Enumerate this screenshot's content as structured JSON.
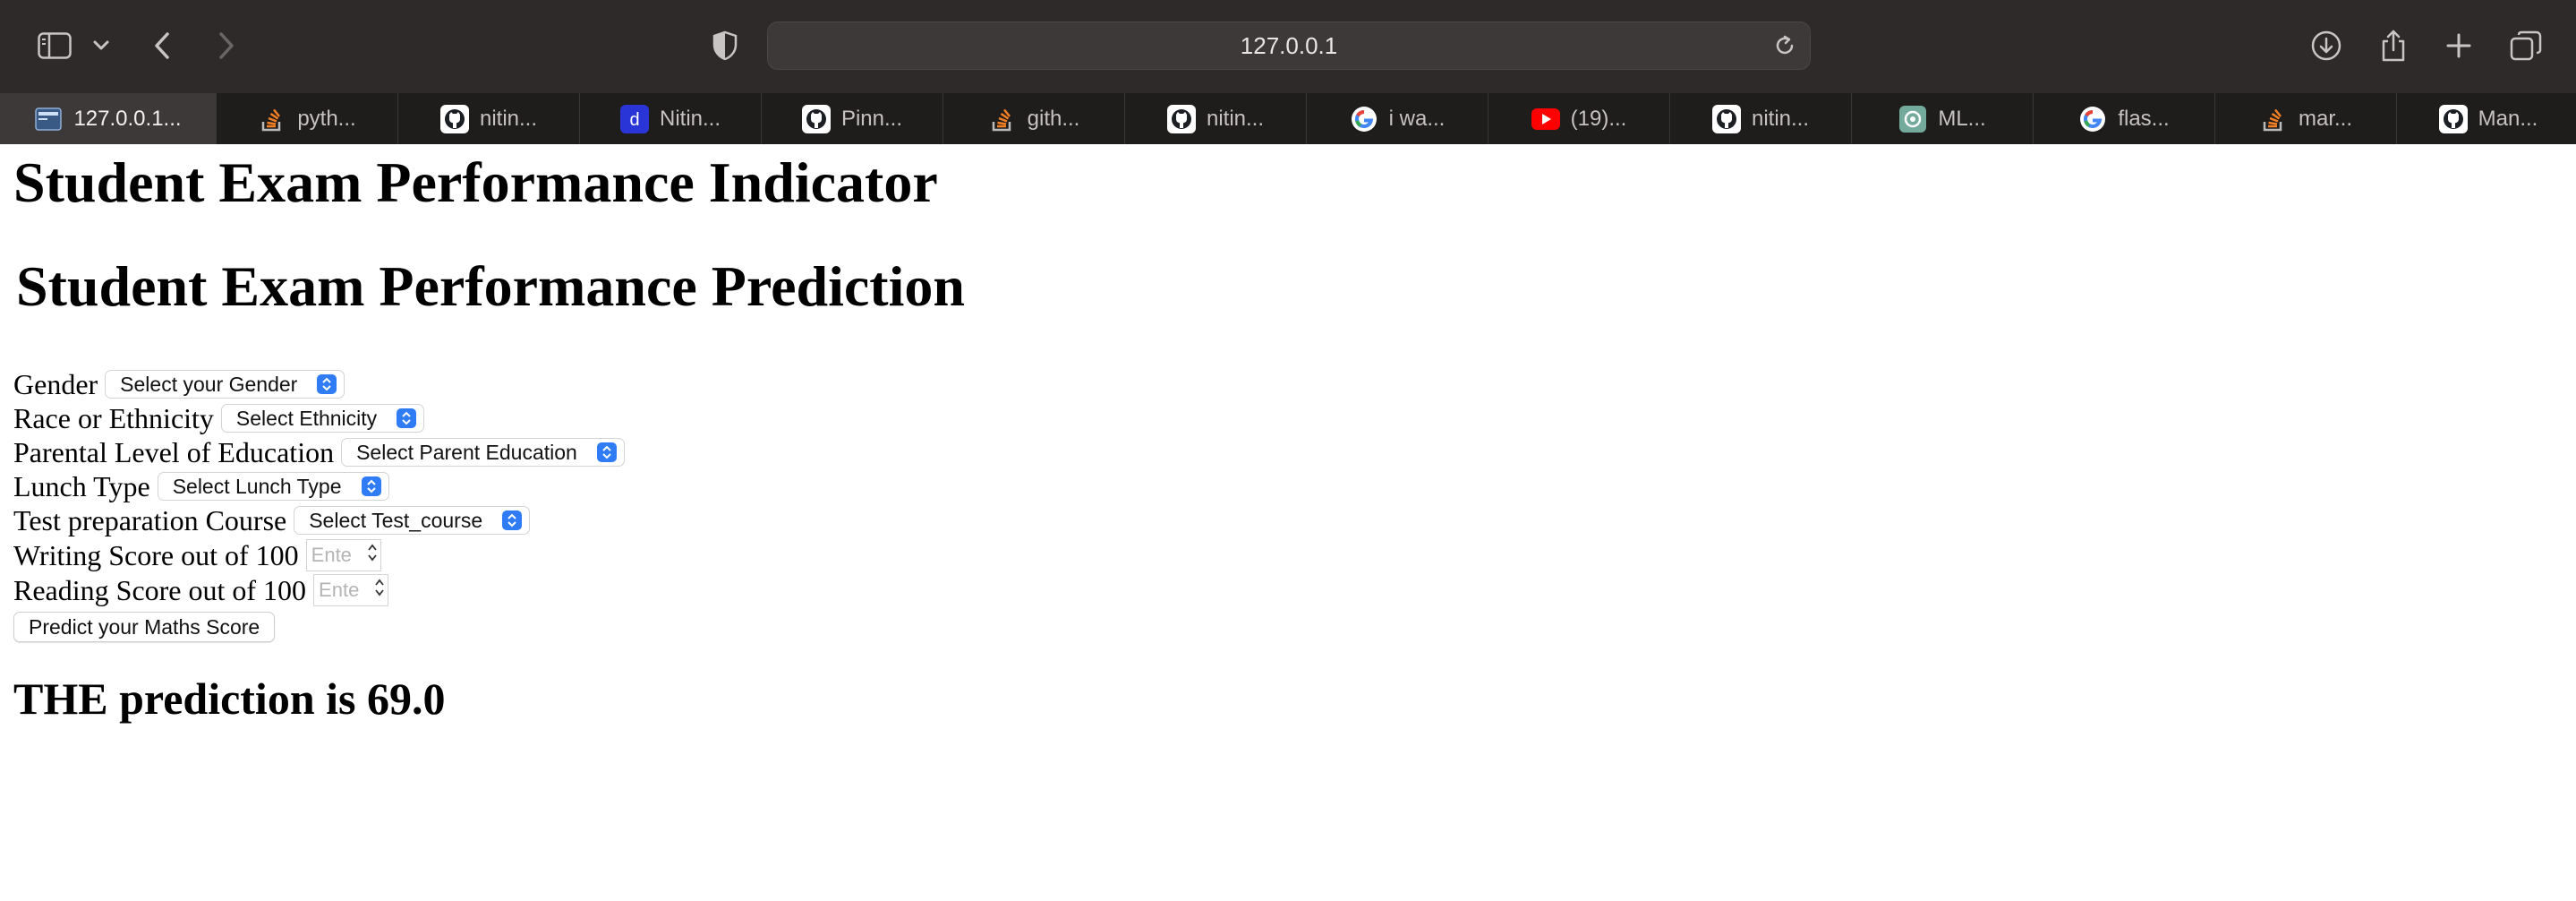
{
  "browser": {
    "address": "127.0.0.1",
    "tabs": [
      {
        "label": "127.0.0.1...",
        "icon": "site-favicon-icon",
        "active": true
      },
      {
        "label": "pyth...",
        "icon": "stackoverflow-icon"
      },
      {
        "label": "nitin...",
        "icon": "github-icon"
      },
      {
        "label": "Nitin...",
        "icon": "dev-letter-d-icon"
      },
      {
        "label": "Pinn...",
        "icon": "github-icon"
      },
      {
        "label": "gith...",
        "icon": "stackoverflow-icon"
      },
      {
        "label": "nitin...",
        "icon": "github-icon"
      },
      {
        "label": "i wa...",
        "icon": "google-icon"
      },
      {
        "label": "(19)...",
        "icon": "youtube-icon"
      },
      {
        "label": "nitin...",
        "icon": "github-icon"
      },
      {
        "label": "ML...",
        "icon": "chatgpt-icon"
      },
      {
        "label": "flas...",
        "icon": "google-icon"
      },
      {
        "label": "mar...",
        "icon": "stackoverflow-icon"
      },
      {
        "label": "Man...",
        "icon": "github-icon"
      }
    ]
  },
  "page": {
    "title": "Student Exam Performance Indicator",
    "heading": "Student Exam Performance Prediction",
    "form": {
      "gender": {
        "label": "Gender",
        "value": "Select your Gender"
      },
      "ethnicity": {
        "label": "Race or Ethnicity",
        "value": "Select Ethnicity"
      },
      "parental_education": {
        "label": "Parental Level of Education",
        "value": "Select Parent Education"
      },
      "lunch": {
        "label": "Lunch Type",
        "value": "Select Lunch Type"
      },
      "test_prep": {
        "label": "Test preparation Course",
        "value": "Select Test_course"
      },
      "writing": {
        "label": "Writing Score out of 100",
        "placeholder": "Ente"
      },
      "reading": {
        "label": "Reading Score out of 100",
        "placeholder": "Ente"
      },
      "submit_label": "Predict your Maths Score"
    },
    "result": "THE prediction is 69.0"
  },
  "colors": {
    "chrome": "#2e2a29",
    "tabstrip": "#1f1c1c",
    "select_accent": "#2f7cf6"
  }
}
